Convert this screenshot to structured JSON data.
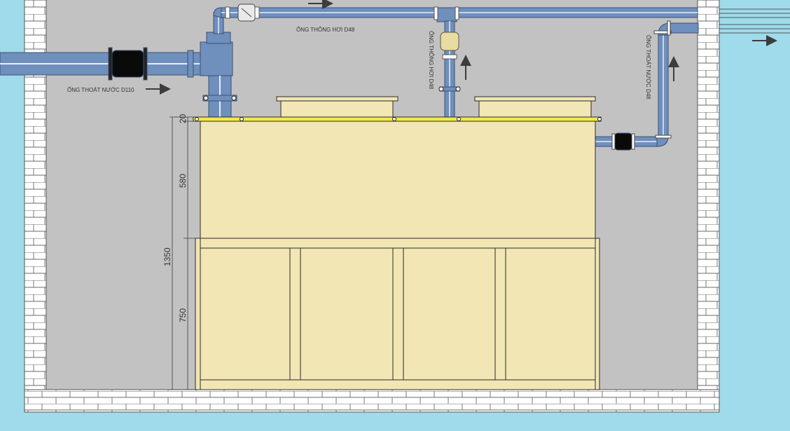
{
  "labels": {
    "drain_d110": "ỐNG THOÁT NƯỚC D110",
    "vent_top_d48": "ỐNG THÔNG HƠI D48",
    "vent_vertical_d48": "ỐNG THÔNG HƠI D48",
    "drain_right_d48": "ỐNG THOÁT NƯỚC D48"
  },
  "dimensions": {
    "top_flange": "20",
    "upper_body": "580",
    "total_height": "1350",
    "base_frame": "750"
  },
  "colors": {
    "sky": "#9fdbea",
    "interior": "#c2c2c2",
    "brick_fill": "#ffffff",
    "brick_line": "#6a6a6a",
    "pipe": "#6f8fbd",
    "pipe_highlight": "#e8eef8",
    "tank": "#f1e6b4",
    "tank_rim": "#f5e84a",
    "outline": "#2a2a2a"
  }
}
